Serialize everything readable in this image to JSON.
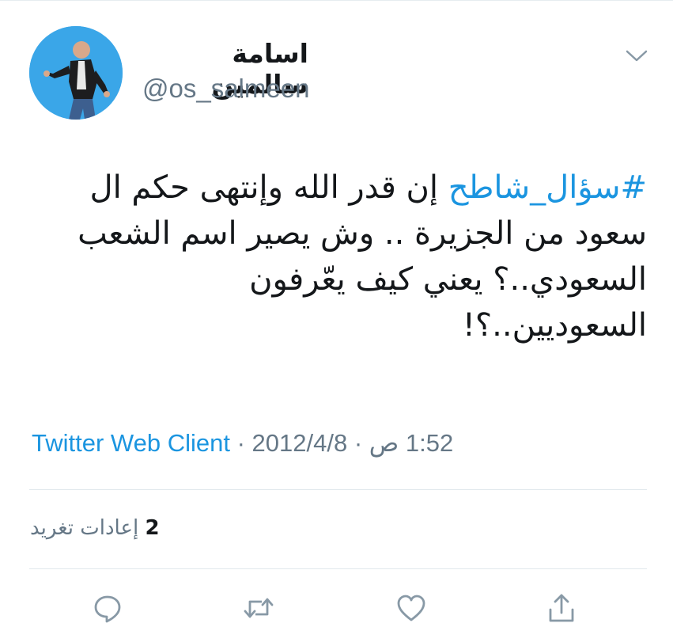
{
  "user": {
    "display_name": "اسامة سالمين",
    "handle": "@os_salmeen"
  },
  "tweet": {
    "hashtag": "#سؤال_شاطح",
    "text_line1_rest": " إن قدر الله وإنتهى حكم ال",
    "text_line2": "سعود من الجزيرة .. وش يصير اسم الشعب",
    "text_line3": "السعودي..؟ يعني كيف يعّرفون",
    "text_line4": "السعوديين..؟!"
  },
  "meta": {
    "time": "1:52 ص",
    "separator1": "·",
    "date": "2012/4/8",
    "separator2": "·",
    "source": "Twitter Web Client"
  },
  "stats": {
    "retweet_count": "2",
    "retweet_label": "إعادات تغريد"
  },
  "actions": {
    "icons": [
      "reply-icon",
      "retweet-icon",
      "like-icon",
      "share-icon"
    ]
  },
  "colors": {
    "link": "#1b95e0",
    "muted": "#657786",
    "text": "#14171a",
    "divider": "#e1e8ed"
  }
}
